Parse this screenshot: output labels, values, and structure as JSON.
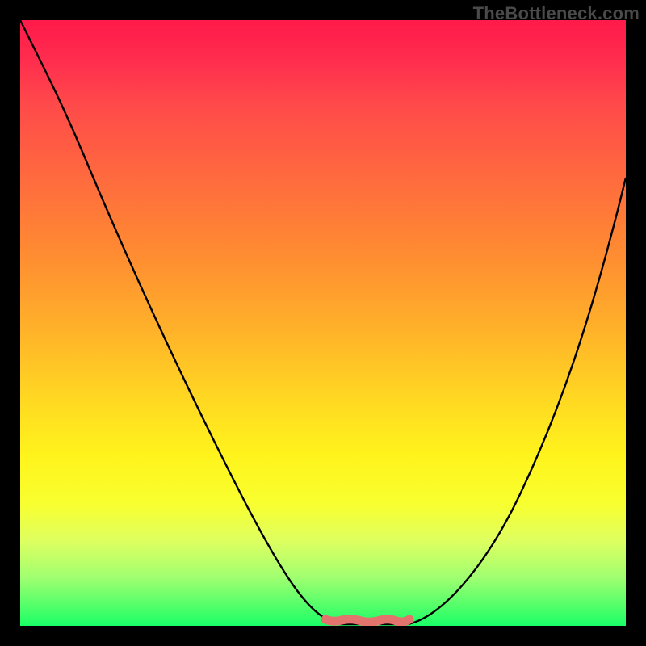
{
  "watermark": "TheBottleneck.com",
  "chart_data": {
    "type": "line",
    "title": "",
    "xlabel": "",
    "ylabel": "",
    "x_range": [
      0,
      1
    ],
    "ylim": [
      0,
      1
    ],
    "series": [
      {
        "name": "primary-curve",
        "color": "#000000",
        "x": [
          0.0,
          0.05,
          0.1,
          0.15,
          0.2,
          0.25,
          0.3,
          0.35,
          0.4,
          0.45,
          0.5,
          0.53,
          0.56,
          0.6,
          0.64,
          0.68,
          0.72,
          0.76,
          0.82,
          0.88,
          0.94,
          1.0
        ],
        "y": [
          1.0,
          0.91,
          0.82,
          0.73,
          0.64,
          0.55,
          0.46,
          0.37,
          0.28,
          0.19,
          0.1,
          0.05,
          0.02,
          0.0,
          0.02,
          0.06,
          0.12,
          0.2,
          0.33,
          0.47,
          0.61,
          0.74
        ]
      },
      {
        "name": "bottom-marker-band",
        "color": "#e2736d",
        "x": [
          0.505,
          0.64
        ],
        "y": [
          0.0,
          0.0
        ]
      }
    ],
    "gradient_stops": [
      {
        "pos": 0.0,
        "color": "#ff1a4a"
      },
      {
        "pos": 0.5,
        "color": "#ffae2a"
      },
      {
        "pos": 0.8,
        "color": "#f8ff30"
      },
      {
        "pos": 1.0,
        "color": "#19ff66"
      }
    ]
  }
}
